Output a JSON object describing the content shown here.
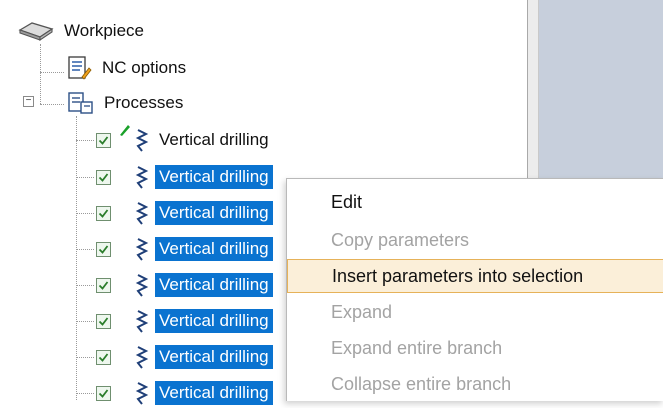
{
  "tree": {
    "root": {
      "label": "Workpiece",
      "icon": "workpiece-icon"
    },
    "nc_options": {
      "label": "NC options",
      "icon": "nc-options-icon"
    },
    "processes": {
      "label": "Processes",
      "icon": "processes-icon",
      "expander": "−"
    },
    "items": [
      {
        "label": "Vertical drilling",
        "checked": true,
        "selected": false,
        "pencil": true
      },
      {
        "label": "Vertical drilling",
        "checked": true,
        "selected": true
      },
      {
        "label": "Vertical drilling",
        "checked": true,
        "selected": true
      },
      {
        "label": "Vertical drilling",
        "checked": true,
        "selected": true
      },
      {
        "label": "Vertical drilling",
        "checked": true,
        "selected": true
      },
      {
        "label": "Vertical drilling",
        "checked": true,
        "selected": true
      },
      {
        "label": "Vertical drilling",
        "checked": true,
        "selected": true
      },
      {
        "label": "Vertical drilling",
        "checked": true,
        "selected": true
      }
    ]
  },
  "context_menu": {
    "items": [
      {
        "label": "Edit",
        "enabled": true
      },
      {
        "label": "Copy parameters",
        "enabled": false
      },
      {
        "label": "Insert parameters into selection",
        "enabled": true,
        "highlighted": true
      },
      {
        "label": "Expand",
        "enabled": false
      },
      {
        "label": "Expand entire branch",
        "enabled": false
      },
      {
        "label": "Collapse entire branch",
        "enabled": false
      }
    ]
  },
  "colors": {
    "selection": "#0a73d0",
    "menu_highlight": "#fbefd9",
    "menu_highlight_border": "#e6b259",
    "right_pane": "#c7cfdc"
  }
}
